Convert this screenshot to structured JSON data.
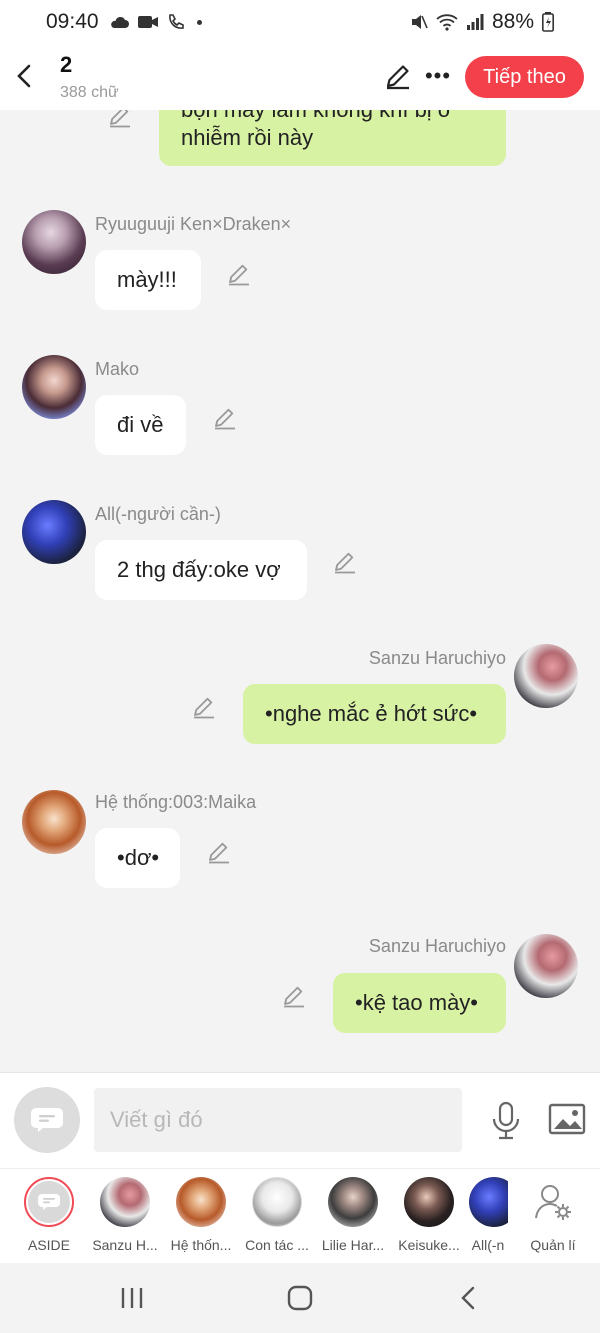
{
  "status": {
    "time": "09:40",
    "battery": "88%"
  },
  "header": {
    "title": "2",
    "subtitle": "388 chữ",
    "next_label": "Tiếp theo"
  },
  "messages": [
    {
      "side": "right",
      "text": "bọn mày làm không khí bị ô nhiễm rồi này"
    },
    {
      "side": "left",
      "name": "Ryuuguuji Ken×Draken×",
      "text": "mày!!!"
    },
    {
      "side": "left",
      "name": "Mako",
      "text": "đi về"
    },
    {
      "side": "left",
      "name": "All(-người cần-)",
      "text": "2 thg đấy:oke vợ"
    },
    {
      "side": "right",
      "name": "Sanzu Haruchiyo",
      "text": "•nghe mắc ẻ hớt sức•"
    },
    {
      "side": "left",
      "name": "Hệ thống:003:Maika",
      "text": "•dơ•"
    },
    {
      "side": "right",
      "name": "Sanzu Haruchiyo",
      "text": "•kệ tao mày•"
    }
  ],
  "composer": {
    "placeholder": "Viết gì đó"
  },
  "characters": [
    {
      "label": "ASIDE",
      "color": "#d9d9d9"
    },
    {
      "label": "Sanzu H...",
      "color": "#c98a8e"
    },
    {
      "label": "Hệ thốn...",
      "color": "#c9702e"
    },
    {
      "label": "Con tác ...",
      "color": "#e9e9e9"
    },
    {
      "label": "Lilie Har...",
      "color": "#3d3d3d"
    },
    {
      "label": "Keisuke...",
      "color": "#2a2222"
    },
    {
      "label": "All(-n",
      "color": "#3a4fb0"
    },
    {
      "label": "Quản lí",
      "color": "#ffffff"
    }
  ],
  "colors": {
    "accent": "#f3404a",
    "bubble_right": "#d8f2a4",
    "bubble_left": "#ffffff"
  }
}
